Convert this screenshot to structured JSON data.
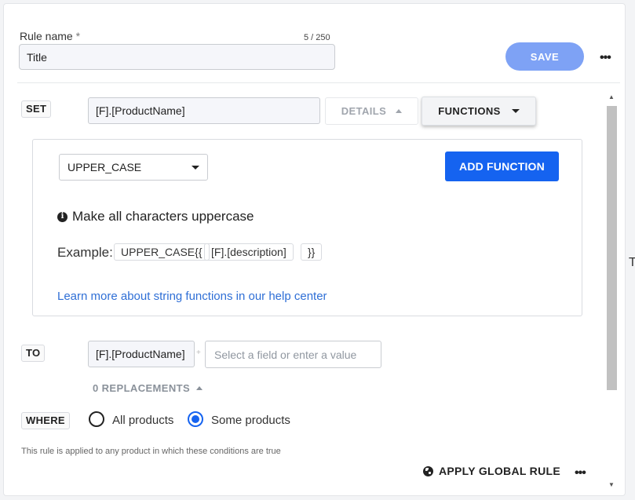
{
  "header": {
    "rule_name_label": "Rule name",
    "required_mark": "*",
    "char_counter": "5 / 250",
    "rule_name_value": "Title",
    "save_label": "SAVE",
    "more_glyph": "•••"
  },
  "set_section": {
    "tag": "SET",
    "field": "[F].[ProductName]",
    "details_label": "DETAILS",
    "functions_label": "FUNCTIONS"
  },
  "function_panel": {
    "selected_function": "UPPER_CASE",
    "add_function_label": "ADD FUNCTION",
    "description": "Make all characters uppercase",
    "example_label": "Example:",
    "example_chips": [
      "UPPER_CASE{{",
      "[F].[description]",
      "}}"
    ],
    "help_link": "Learn more about string functions in our help center"
  },
  "to_section": {
    "tag": "TO",
    "field": "[F].[ProductName]",
    "plus_glyph": "+",
    "value_placeholder": "Select a field or enter a value",
    "replacements_label": "0 REPLACEMENTS"
  },
  "where_section": {
    "tag": "WHERE",
    "options": [
      {
        "label": "All products",
        "checked": false
      },
      {
        "label": "Some products",
        "checked": true
      }
    ],
    "note": "This rule is applied to any product in which these conditions are true"
  },
  "footer": {
    "apply_global_label": "APPLY GLOBAL RULE",
    "more_glyph": "•••"
  },
  "colors": {
    "primary": "#1563f0",
    "save_button": "#7ea2f5",
    "link": "#2f6fd6"
  },
  "icons": [
    "info-icon",
    "globe-icon",
    "chevron-down-icon",
    "chevron-up-icon",
    "more-icon"
  ]
}
